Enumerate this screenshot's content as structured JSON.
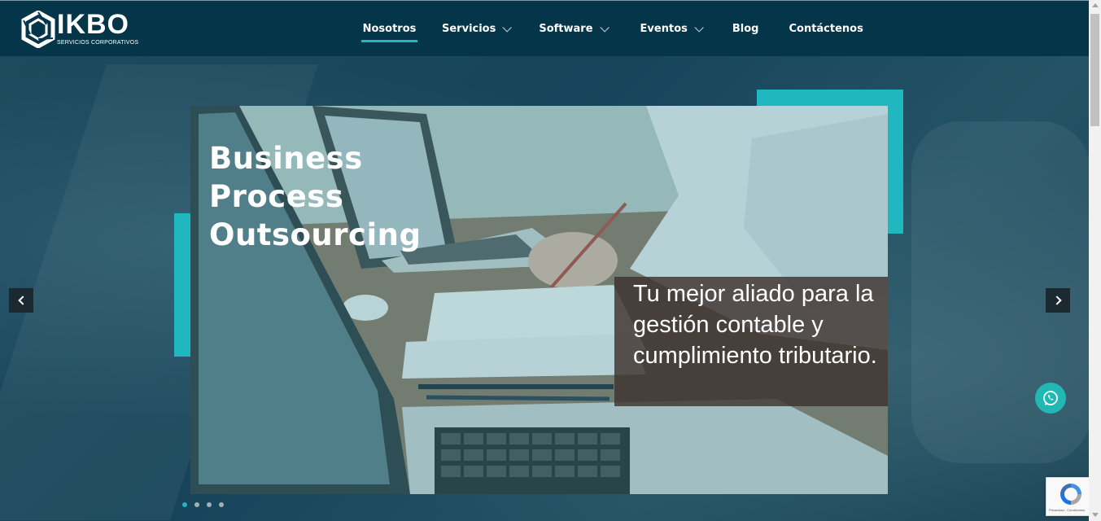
{
  "brand": {
    "name": "IKBO",
    "tagline": "SERVICIOS CORPORATIVOS",
    "logo_icon": "hexagon-logo-icon"
  },
  "nav": {
    "items": [
      {
        "label": "Nosotros",
        "active": true,
        "has_dropdown": false
      },
      {
        "label": "Servicios",
        "active": false,
        "has_dropdown": true
      },
      {
        "label": "Software",
        "active": false,
        "has_dropdown": true
      },
      {
        "label": "Eventos",
        "active": false,
        "has_dropdown": true
      },
      {
        "label": "Blog",
        "active": false,
        "has_dropdown": false
      },
      {
        "label": "Contáctenos",
        "active": false,
        "has_dropdown": false
      }
    ]
  },
  "hero": {
    "title_lines": [
      "Business",
      "Process",
      "Outsourcing"
    ],
    "caption": "Tu mejor aliado para la gestión contable y cumplimiento tributario.",
    "prev_icon": "chevron-left-icon",
    "next_icon": "chevron-right-icon",
    "slides_total": 4,
    "active_slide": 1
  },
  "floating": {
    "whatsapp_icon": "whatsapp-icon",
    "recaptcha_text": "Privacidad - Condiciones"
  },
  "colors": {
    "header_bg": "#053549",
    "accent": "#1fb8c0",
    "nav_underline": "#23b8b8",
    "caption_bg": "#3e322e"
  }
}
